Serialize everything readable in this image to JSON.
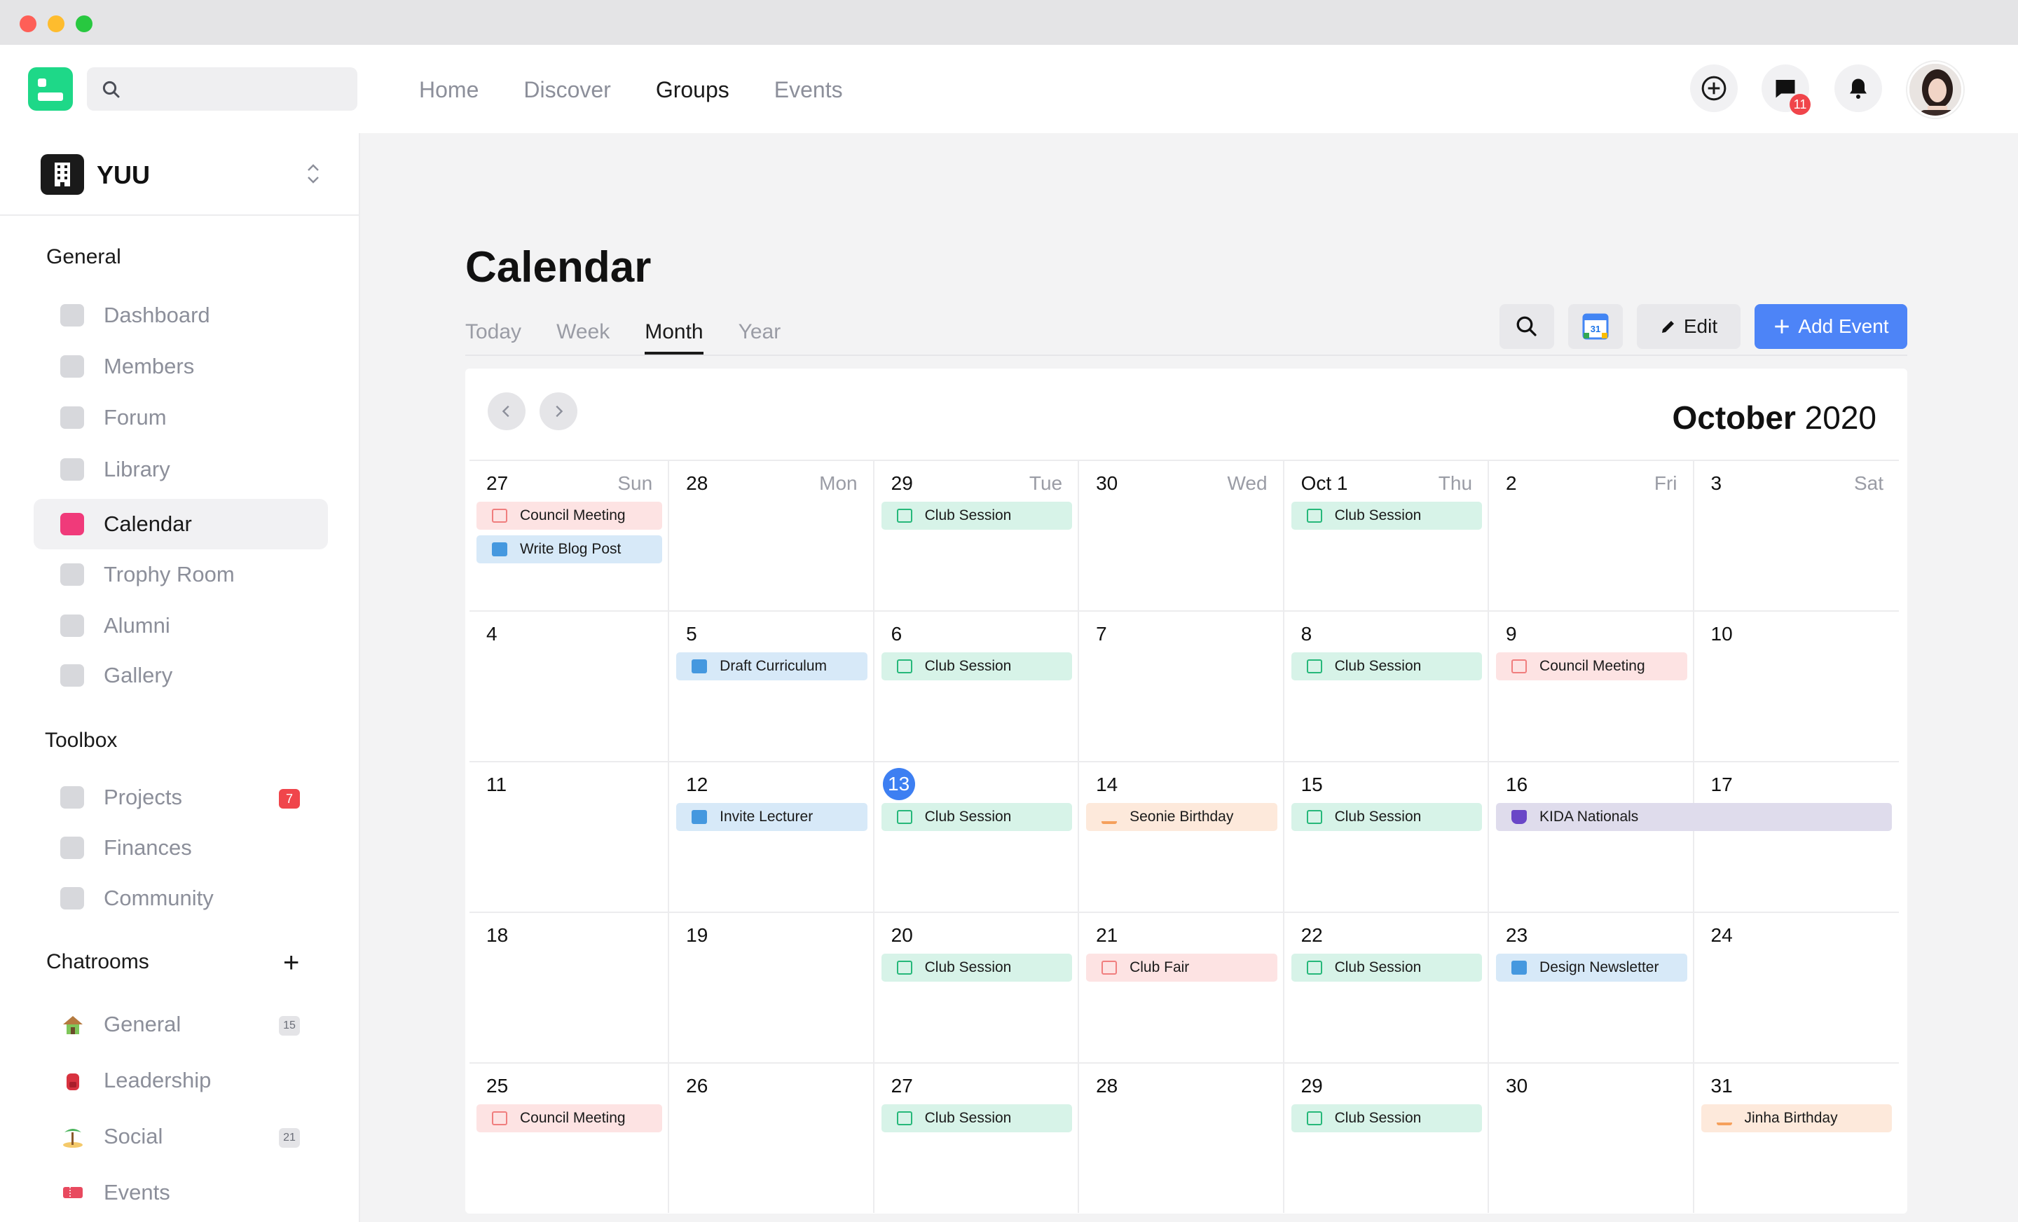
{
  "nav": {
    "links": [
      "Home",
      "Discover",
      "Groups",
      "Events"
    ],
    "active": "Groups",
    "message_count": "11"
  },
  "org": {
    "name": "YUU"
  },
  "sidebar": {
    "general_title": "General",
    "general_items": [
      "Dashboard",
      "Members",
      "Forum",
      "Library",
      "Calendar",
      "Trophy Room",
      "Alumni",
      "Gallery"
    ],
    "active_item": "Calendar",
    "toolbox_title": "Toolbox",
    "toolbox_items": [
      "Projects",
      "Finances",
      "Community"
    ],
    "projects_badge": "7",
    "chatrooms_title": "Chatrooms",
    "chatrooms": [
      {
        "label": "General",
        "badge": "15"
      },
      {
        "label": "Leadership",
        "badge": ""
      },
      {
        "label": "Social",
        "badge": "21"
      },
      {
        "label": "Events",
        "badge": ""
      }
    ]
  },
  "main": {
    "title": "Calendar",
    "view_tabs": [
      "Today",
      "Week",
      "Month",
      "Year"
    ],
    "active_view": "Month",
    "gcal_label": "31",
    "edit_label": "Edit",
    "add_event_label": "Add Event",
    "month_name": "October",
    "year": "2020",
    "weekdays": [
      "Sun",
      "Mon",
      "Tue",
      "Wed",
      "Thu",
      "Fri",
      "Sat"
    ],
    "today": "13",
    "weeks": [
      [
        "27",
        "28",
        "29",
        "30",
        "Oct 1",
        "2",
        "3"
      ],
      [
        "4",
        "5",
        "6",
        "7",
        "8",
        "9",
        "10"
      ],
      [
        "11",
        "12",
        "13",
        "14",
        "15",
        "16",
        "17"
      ],
      [
        "18",
        "19",
        "20",
        "21",
        "22",
        "23",
        "24"
      ],
      [
        "25",
        "26",
        "27",
        "28",
        "29",
        "30",
        "31"
      ]
    ],
    "events": [
      {
        "week": 0,
        "day": 0,
        "slot": 0,
        "span": 1,
        "label": "Council Meeting",
        "color": "red",
        "icon": "calendar-icon"
      },
      {
        "week": 0,
        "day": 0,
        "slot": 1,
        "span": 1,
        "label": "Write Blog Post",
        "color": "blue",
        "icon": "briefcase-icon"
      },
      {
        "week": 0,
        "day": 2,
        "slot": 0,
        "span": 1,
        "label": "Club Session",
        "color": "green",
        "icon": "calendar-icon"
      },
      {
        "week": 0,
        "day": 4,
        "slot": 0,
        "span": 1,
        "label": "Club Session",
        "color": "green",
        "icon": "calendar-icon"
      },
      {
        "week": 1,
        "day": 1,
        "slot": 0,
        "span": 1,
        "label": "Draft Curriculum",
        "color": "blue",
        "icon": "briefcase-icon"
      },
      {
        "week": 1,
        "day": 2,
        "slot": 0,
        "span": 1,
        "label": "Club Session",
        "color": "green",
        "icon": "calendar-icon"
      },
      {
        "week": 1,
        "day": 4,
        "slot": 0,
        "span": 1,
        "label": "Club Session",
        "color": "green",
        "icon": "calendar-icon"
      },
      {
        "week": 1,
        "day": 5,
        "slot": 0,
        "span": 1,
        "label": "Council Meeting",
        "color": "red",
        "icon": "calendar-icon"
      },
      {
        "week": 2,
        "day": 1,
        "slot": 0,
        "span": 1,
        "label": "Invite Lecturer",
        "color": "blue",
        "icon": "briefcase-icon"
      },
      {
        "week": 2,
        "day": 2,
        "slot": 0,
        "span": 1,
        "label": "Club Session",
        "color": "green",
        "icon": "calendar-icon"
      },
      {
        "week": 2,
        "day": 3,
        "slot": 0,
        "span": 1,
        "label": "Seonie Birthday",
        "color": "orange",
        "icon": "cake-icon"
      },
      {
        "week": 2,
        "day": 4,
        "slot": 0,
        "span": 1,
        "label": "Club Session",
        "color": "green",
        "icon": "calendar-icon"
      },
      {
        "week": 2,
        "day": 5,
        "slot": 0,
        "span": 2,
        "label": "KIDA Nationals",
        "color": "purple",
        "icon": "trophy-icon"
      },
      {
        "week": 3,
        "day": 2,
        "slot": 0,
        "span": 1,
        "label": "Club Session",
        "color": "green",
        "icon": "calendar-icon"
      },
      {
        "week": 3,
        "day": 3,
        "slot": 0,
        "span": 1,
        "label": "Club Fair",
        "color": "red",
        "icon": "calendar-icon"
      },
      {
        "week": 3,
        "day": 4,
        "slot": 0,
        "span": 1,
        "label": "Club Session",
        "color": "green",
        "icon": "calendar-icon"
      },
      {
        "week": 3,
        "day": 5,
        "slot": 0,
        "span": 1,
        "label": "Design Newsletter",
        "color": "blue",
        "icon": "briefcase-icon"
      },
      {
        "week": 4,
        "day": 0,
        "slot": 0,
        "span": 1,
        "label": "Council Meeting",
        "color": "red",
        "icon": "calendar-icon"
      },
      {
        "week": 4,
        "day": 2,
        "slot": 0,
        "span": 1,
        "label": "Club Session",
        "color": "green",
        "icon": "calendar-icon"
      },
      {
        "week": 4,
        "day": 4,
        "slot": 0,
        "span": 1,
        "label": "Club Session",
        "color": "green",
        "icon": "calendar-icon"
      },
      {
        "week": 4,
        "day": 6,
        "slot": 0,
        "span": 1,
        "label": "Jinha Birthday",
        "color": "orange",
        "icon": "cake-icon"
      }
    ]
  }
}
